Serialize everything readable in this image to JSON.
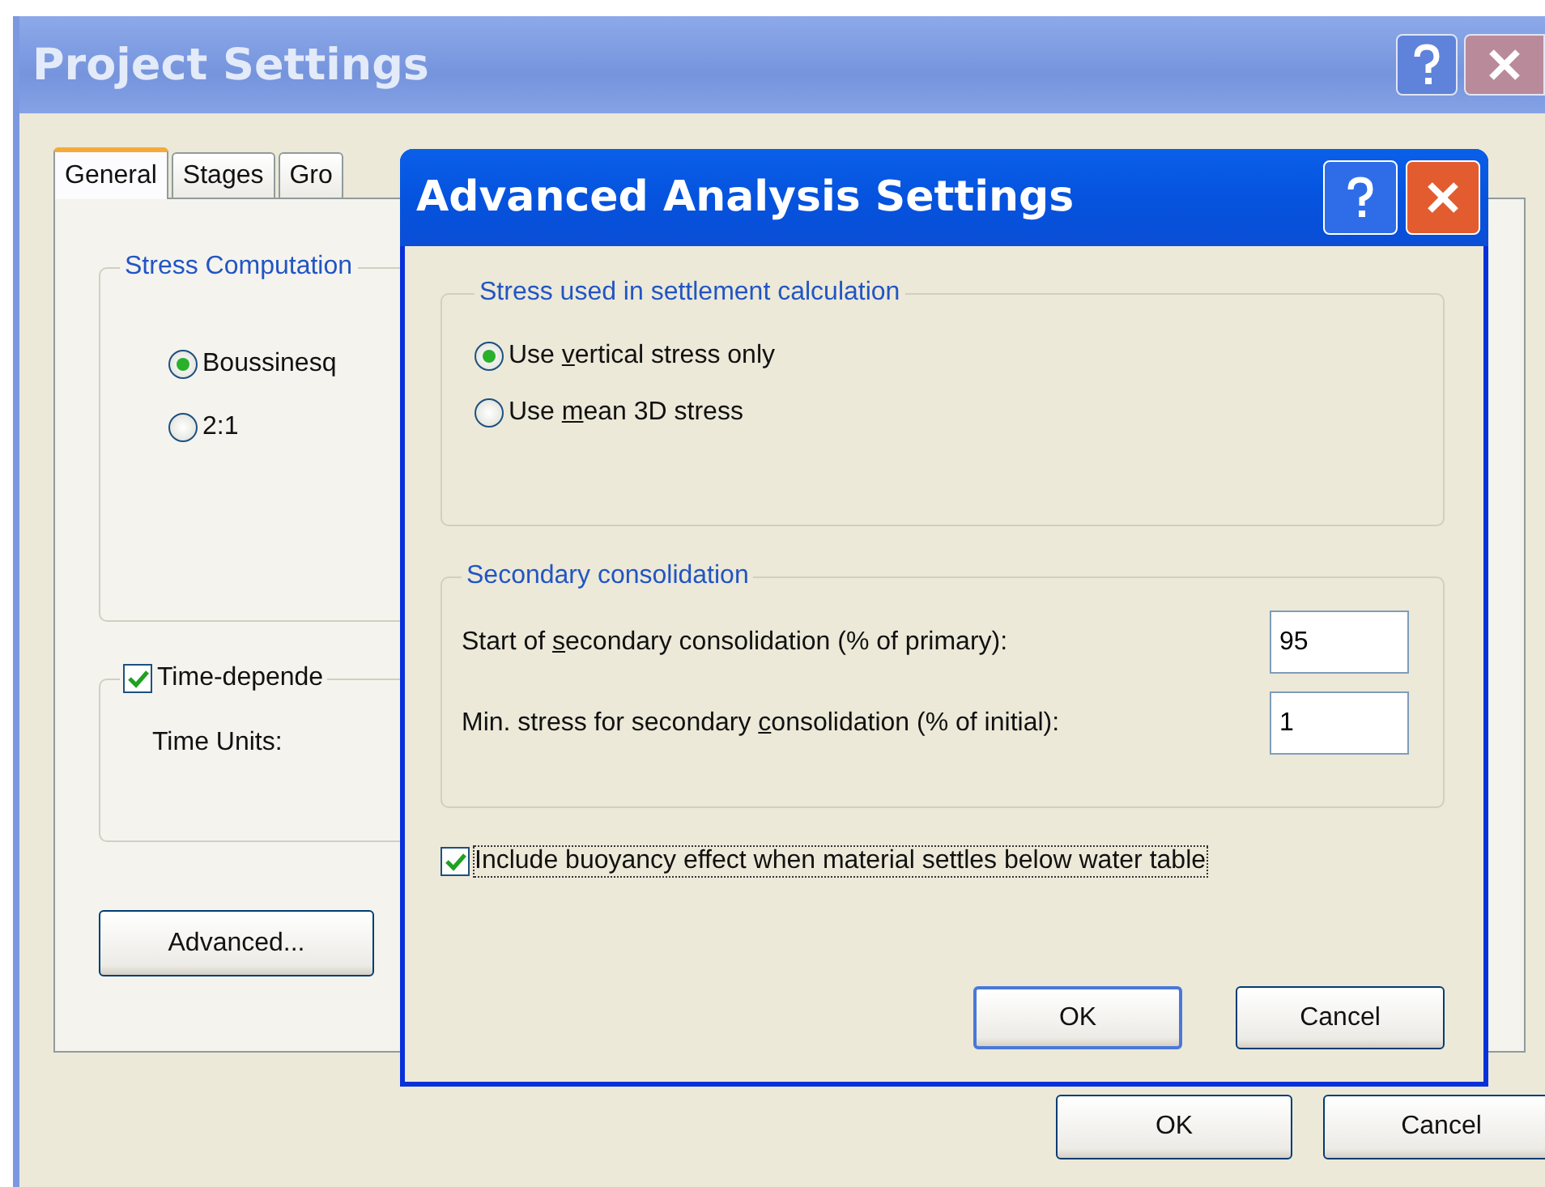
{
  "window": {
    "title": "Project Settings"
  },
  "tabs": [
    {
      "label": "General",
      "selected": true
    },
    {
      "label": "Stages",
      "selected": false
    },
    {
      "label": "Gro",
      "selected": false
    }
  ],
  "stress_computation": {
    "title": "Stress Computation",
    "options": [
      {
        "label": "Boussinesq",
        "selected": true
      },
      {
        "label": "2:1",
        "selected": false
      }
    ]
  },
  "time_dependent": {
    "label": "Time-depende",
    "checked": true,
    "time_units_label": "Time Units:"
  },
  "advanced_button": "Advanced...",
  "buttons": [
    "OK",
    "Cancel"
  ],
  "dialog": {
    "title": "Advanced Analysis Settings",
    "stress_group": {
      "title": "Stress used in settlement calculation",
      "options": [
        {
          "label_parts": [
            "Use ",
            "v",
            "ertical stress only"
          ],
          "selected": true
        },
        {
          "label_parts": [
            "Use ",
            "m",
            "ean 3D stress"
          ],
          "selected": false
        }
      ]
    },
    "secondary_group": {
      "title": "Secondary consolidation",
      "fields": [
        {
          "label_parts": [
            "Start of ",
            "s",
            "econdary consolidation (% of primary):"
          ],
          "value": "95"
        },
        {
          "label_parts": [
            "Min. stress for secondary ",
            "c",
            "onsolidation (% of initial):"
          ],
          "value": "1"
        }
      ]
    },
    "buoyancy": {
      "label": "Include buoyancy effect when material settles below water table",
      "checked": true
    },
    "buttons": [
      "OK",
      "Cancel"
    ]
  }
}
